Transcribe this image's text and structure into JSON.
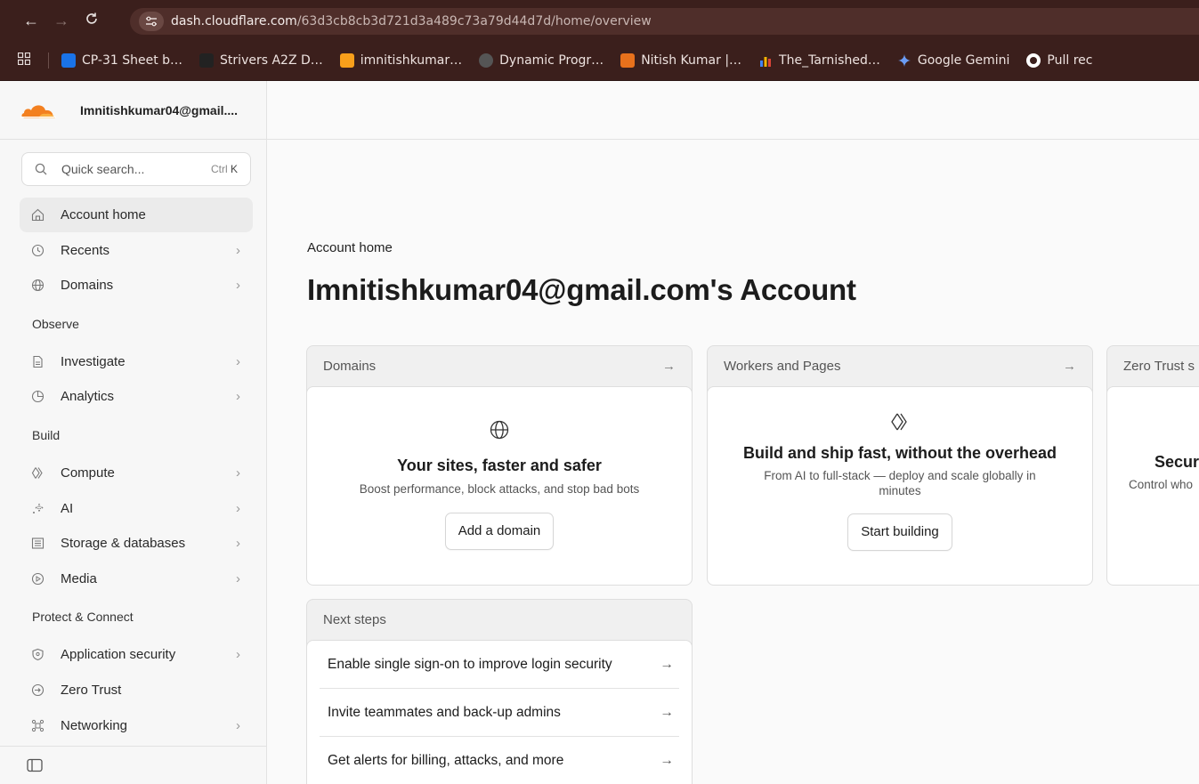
{
  "browser": {
    "url_host": "dash.cloudflare.com",
    "url_path": "/63d3cb8cb3d721d3a489c73a79d44d7d/home/overview",
    "bookmarks": [
      {
        "label": "CP-31 Sheet b…",
        "icon": "cp31-icon",
        "color": "#1a73e8"
      },
      {
        "label": "Strivers A2Z D…",
        "icon": "tuf-icon",
        "color": "#222222"
      },
      {
        "label": "imnitishkumar…",
        "icon": "leetcode-icon",
        "color": "#f89f1b"
      },
      {
        "label": "Dynamic Progr…",
        "icon": "globe-icon",
        "color": "#555555"
      },
      {
        "label": "Nitish Kumar |…",
        "icon": "tiger-icon",
        "color": "#e8711c"
      },
      {
        "label": "The_Tarnished…",
        "icon": "bar-chart-icon",
        "color": "#f4b400"
      },
      {
        "label": "Google Gemini",
        "icon": "gemini-icon",
        "color": "#4285f4"
      },
      {
        "label": "Pull rec",
        "icon": "github-icon",
        "color": "#ffffff"
      }
    ]
  },
  "sidebar": {
    "account_name": "Imnitishkumar04@gmail....",
    "search": {
      "placeholder": "Quick search...",
      "shortcut_mod": "Ctrl",
      "shortcut_key": "K"
    },
    "top_items": [
      {
        "label": "Account home",
        "icon": "home-icon",
        "active": true,
        "chevron": false
      },
      {
        "label": "Recents",
        "icon": "history-icon",
        "chevron": true
      },
      {
        "label": "Domains",
        "icon": "globe-icon",
        "chevron": true
      }
    ],
    "sections": [
      {
        "title": "Observe",
        "items": [
          {
            "label": "Investigate",
            "icon": "document-icon",
            "chevron": true
          },
          {
            "label": "Analytics",
            "icon": "pie-chart-icon",
            "chevron": true
          }
        ]
      },
      {
        "title": "Build",
        "items": [
          {
            "label": "Compute",
            "icon": "compute-icon",
            "chevron": true
          },
          {
            "label": "AI",
            "icon": "sparkle-icon",
            "chevron": true
          },
          {
            "label": "Storage & databases",
            "icon": "storage-icon",
            "chevron": true
          },
          {
            "label": "Media",
            "icon": "play-icon",
            "chevron": true
          }
        ]
      },
      {
        "title": "Protect & Connect",
        "items": [
          {
            "label": "Application security",
            "icon": "shield-icon",
            "chevron": true
          },
          {
            "label": "Zero Trust",
            "icon": "zero-trust-icon",
            "chevron": false
          },
          {
            "label": "Networking",
            "icon": "network-icon",
            "chevron": true
          }
        ]
      }
    ]
  },
  "main": {
    "breadcrumb": "Account home",
    "title": "Imnitishkumar04@gmail.com's Account",
    "cards": {
      "domains": {
        "header": "Domains",
        "heading": "Your sites, faster and safer",
        "desc": "Boost performance, block attacks, and stop bad bots",
        "button": "Add a domain"
      },
      "workers": {
        "header": "Workers and Pages",
        "heading": "Build and ship fast, without the overhead",
        "desc_line1": "From AI to full-stack — deploy and scale globally in",
        "desc_line2": "minutes",
        "button": "Start building"
      },
      "zerotrust": {
        "header": "Zero Trust s",
        "heading": "Secur",
        "desc": "Control who"
      }
    },
    "next_steps": {
      "header": "Next steps",
      "items": [
        "Enable single sign-on to improve login security",
        "Invite teammates and back-up admins",
        "Get alerts for billing, attacks, and more"
      ]
    }
  },
  "colors": {
    "brand": "#f38020",
    "browser_chrome": "#3b1f1c"
  }
}
